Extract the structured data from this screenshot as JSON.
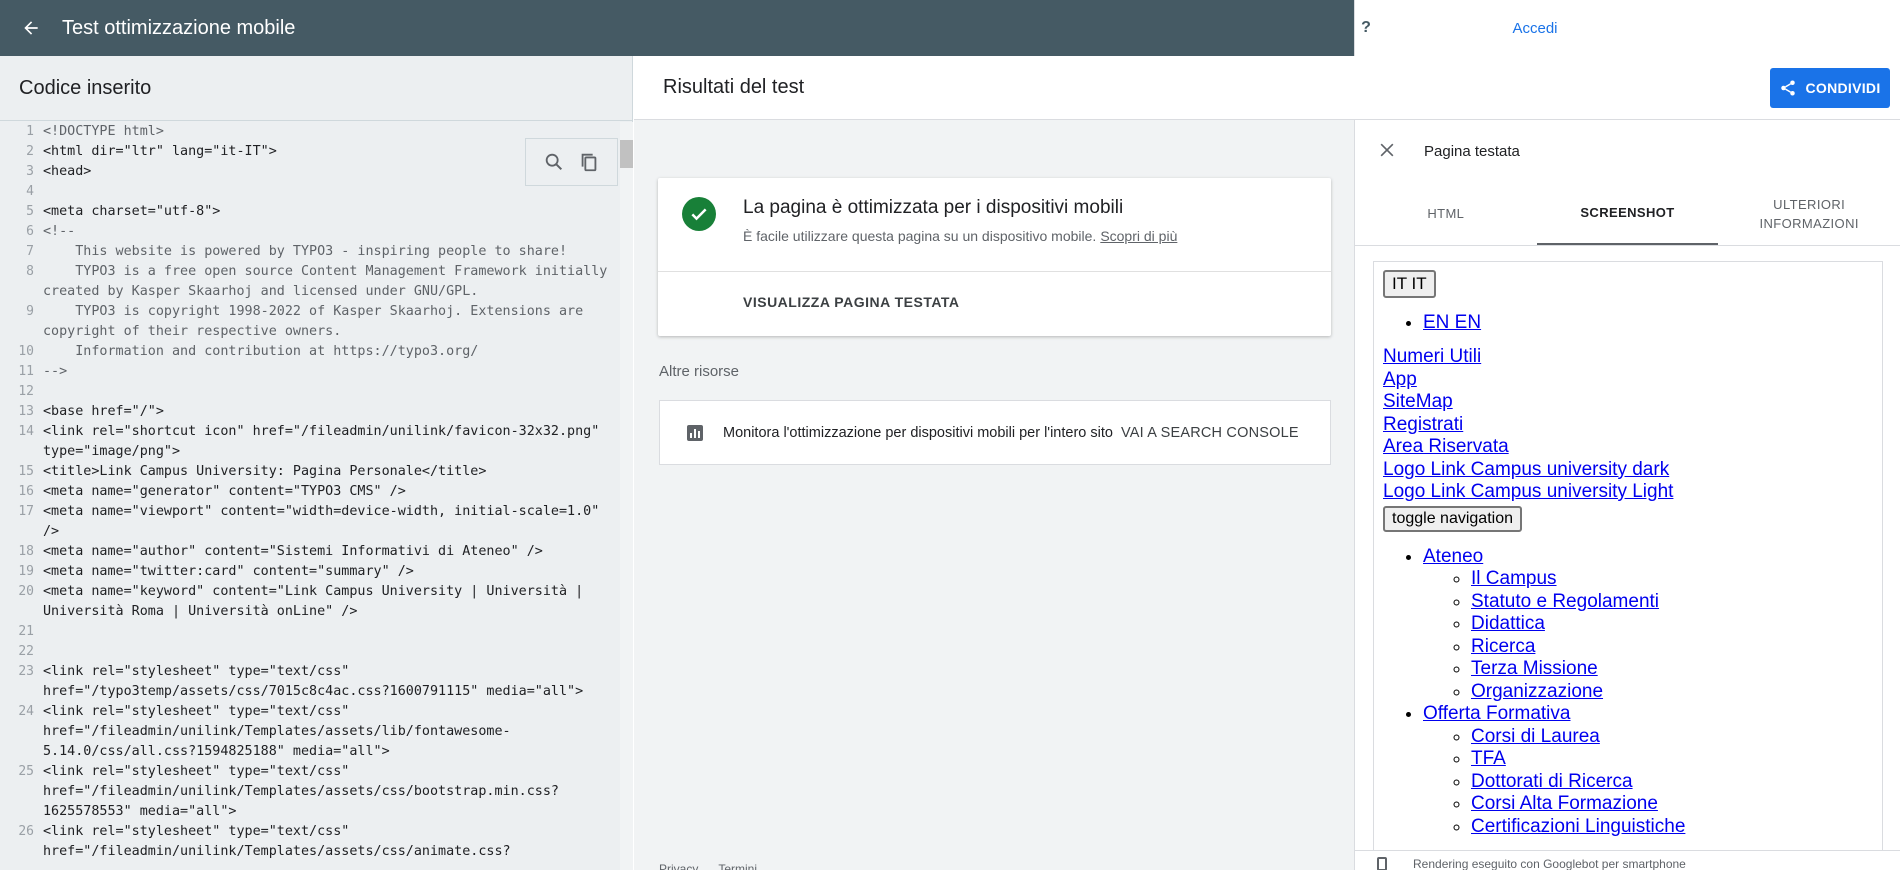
{
  "header": {
    "title": "Test ottimizzazione mobile",
    "login_label": "Accedi"
  },
  "left_panel": {
    "title": "Codice inserito",
    "lines": [
      {
        "n": "1",
        "t": "<!DOCTYPE html>",
        "c": true
      },
      {
        "n": "2",
        "t": "<html dir=\"ltr\" lang=\"it-IT\">"
      },
      {
        "n": "3",
        "t": "<head>"
      },
      {
        "n": "4",
        "t": ""
      },
      {
        "n": "5",
        "t": "<meta charset=\"utf-8\">"
      },
      {
        "n": "6",
        "t": "<!--",
        "c": true
      },
      {
        "n": "7",
        "t": "    This website is powered by TYPO3 - inspiring people to share!",
        "c": true
      },
      {
        "n": "8",
        "t": "    TYPO3 is a free open source Content Management Framework initially created by Kasper Skaarhoj and licensed under GNU/GPL.",
        "c": true
      },
      {
        "n": "9",
        "t": "    TYPO3 is copyright 1998-2022 of Kasper Skaarhoj. Extensions are copyright of their respective owners.",
        "c": true
      },
      {
        "n": "10",
        "t": "    Information and contribution at https://typo3.org/",
        "c": true
      },
      {
        "n": "11",
        "t": "-->",
        "c": true
      },
      {
        "n": "12",
        "t": ""
      },
      {
        "n": "13",
        "t": "<base href=\"/\">"
      },
      {
        "n": "14",
        "t": "<link rel=\"shortcut icon\" href=\"/fileadmin/unilink/favicon-32x32.png\" type=\"image/png\">"
      },
      {
        "n": "15",
        "t": "<title>Link Campus University: Pagina Personale</title>"
      },
      {
        "n": "16",
        "t": "<meta name=\"generator\" content=\"TYPO3 CMS\" />"
      },
      {
        "n": "17",
        "t": "<meta name=\"viewport\" content=\"width=device-width, initial-scale=1.0\" />"
      },
      {
        "n": "18",
        "t": "<meta name=\"author\" content=\"Sistemi Informativi di Ateneo\" />"
      },
      {
        "n": "19",
        "t": "<meta name=\"twitter:card\" content=\"summary\" />"
      },
      {
        "n": "20",
        "t": "<meta name=\"keyword\" content=\"Link Campus University | Università | Università Roma | Università onLine\" />"
      },
      {
        "n": "21",
        "t": ""
      },
      {
        "n": "22",
        "t": ""
      },
      {
        "n": "23",
        "t": "<link rel=\"stylesheet\" type=\"text/css\" href=\"/typo3temp/assets/css/7015c8c4ac.css?1600791115\" media=\"all\">"
      },
      {
        "n": "24",
        "t": "<link rel=\"stylesheet\" type=\"text/css\" href=\"/fileadmin/unilink/Templates/assets/lib/fontawesome-5.14.0/css/all.css?1594825188\" media=\"all\">"
      },
      {
        "n": "25",
        "t": "<link rel=\"stylesheet\" type=\"text/css\" href=\"/fileadmin/unilink/Templates/assets/css/bootstrap.min.css?1625578553\" media=\"all\">"
      },
      {
        "n": "26",
        "t": "<link rel=\"stylesheet\" type=\"text/css\" href=\"/fileadmin/unilink/Templates/assets/css/animate.css?"
      }
    ]
  },
  "results": {
    "title": "Risultati del test",
    "share_label": "CONDIVIDI",
    "verdict": "La pagina è ottimizzata per i dispositivi mobili",
    "verdict_sub": "È facile utilizzare questa pagina su un dispositivo mobile.",
    "learn_more": "Scopri di più",
    "view_page": "VISUALIZZA PAGINA TESTATA",
    "other_resources": "Altre risorse",
    "monitor_text": "Monitora l'ottimizzazione per dispositivi mobili per l'intero sito",
    "monitor_link": "VAI A SEARCH CONSOLE",
    "footer_privacy": "Privacy",
    "footer_terms": "Termini"
  },
  "tested_page": {
    "title": "Pagina testata",
    "tabs": [
      "HTML",
      "SCREENSHOT",
      "ULTERIORI INFORMAZIONI"
    ],
    "active_tab": "SCREENSHOT",
    "screenshot": {
      "it_button": "IT  IT",
      "en_link": "EN  EN",
      "top_links": [
        "Numeri Utili",
        "App",
        "SiteMap",
        "Registrati",
        "Area Riservata",
        "Logo Link Campus university dark",
        "Logo Link Campus university Light"
      ],
      "toggle_label": "toggle navigation",
      "menu": [
        {
          "label": "Ateneo",
          "children": [
            "Il Campus",
            "Statuto e Regolamenti",
            "Didattica",
            "Ricerca",
            "Terza Missione",
            "Organizzazione"
          ]
        },
        {
          "label": "Offerta Formativa",
          "children": [
            "Corsi di Laurea",
            "TFA",
            "Dottorati di Ricerca",
            "Corsi Alta Formazione",
            "Certificazioni Linguistiche"
          ]
        }
      ]
    },
    "footer_text": "Rendering eseguito con Googlebot per smartphone"
  }
}
